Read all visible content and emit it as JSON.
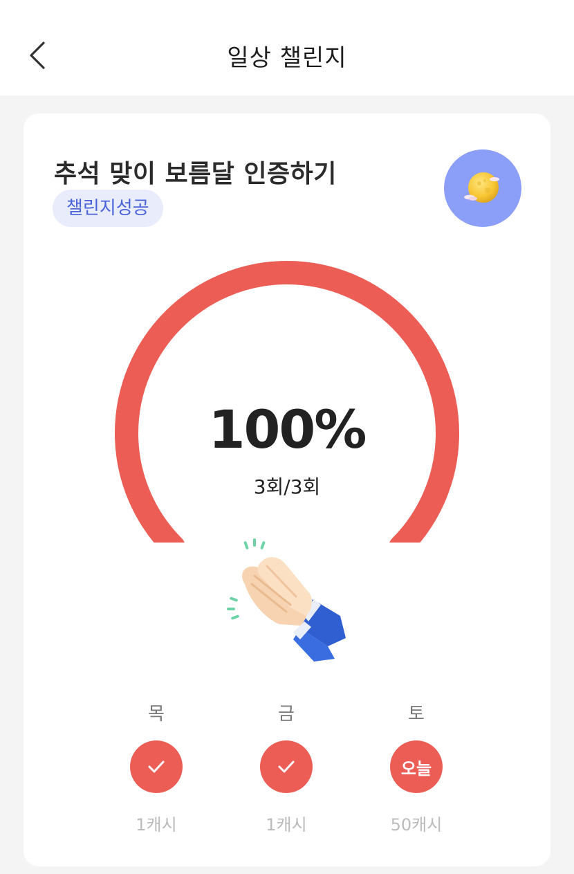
{
  "header": {
    "title": "일상 챌린지",
    "back_icon": "chevron-left-icon"
  },
  "challenge": {
    "title": "추석 맞이 보름달 인증하기",
    "badge": "챌린지성공",
    "emoji_icon": "full-moon-icon",
    "emoji_bg": "#8b9ef8"
  },
  "progress": {
    "percent_label": "100%",
    "count_label": "3회/3회",
    "fraction": 1.0,
    "color": "#ec5d55",
    "celebration_icon": "clapping-hands-icon"
  },
  "days": [
    {
      "label": "목",
      "state": "done",
      "icon": "check-icon",
      "reward": "1캐시"
    },
    {
      "label": "금",
      "state": "done",
      "icon": "check-icon",
      "reward": "1캐시"
    },
    {
      "label": "토",
      "state": "today",
      "text": "오늘",
      "reward": "50캐시"
    }
  ],
  "colors": {
    "accent": "#ec5d55",
    "badge_text": "#4a63d8",
    "badge_bg": "#e8ecfb"
  }
}
